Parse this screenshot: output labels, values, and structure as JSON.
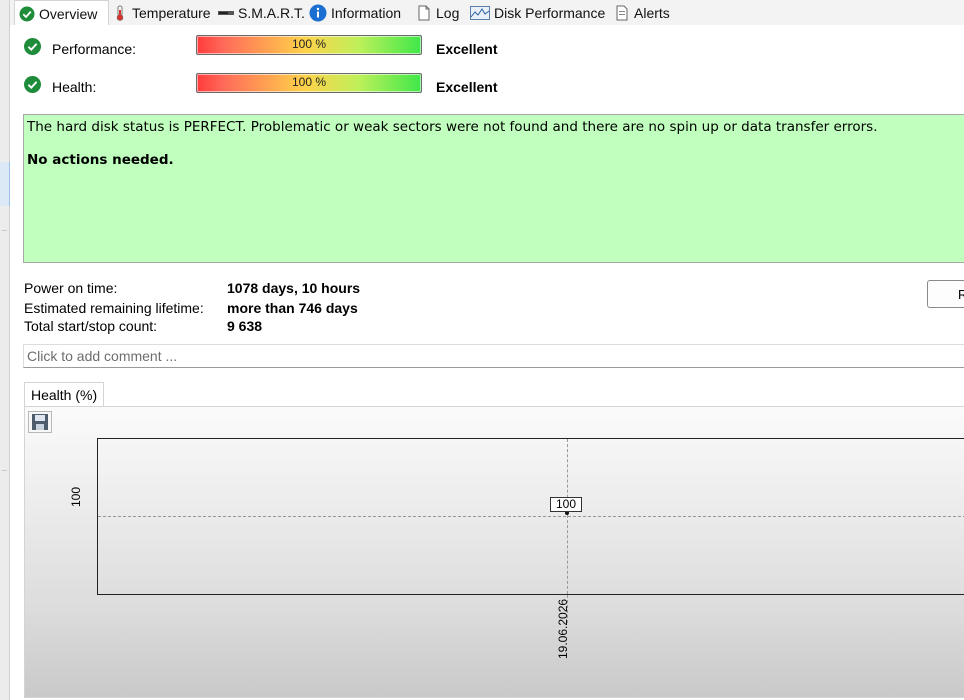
{
  "tabs": [
    {
      "label": "Overview",
      "icon": "check-circle-icon",
      "active": true
    },
    {
      "label": "Temperature",
      "icon": "thermometer-icon"
    },
    {
      "label": "S.M.A.R.T.",
      "icon": "disk-icon"
    },
    {
      "label": "Information",
      "icon": "info-icon"
    },
    {
      "label": "Log",
      "icon": "document-icon"
    },
    {
      "label": "Disk Performance",
      "icon": "chart-icon"
    },
    {
      "label": "Alerts",
      "icon": "alert-document-icon"
    }
  ],
  "performance": {
    "label": "Performance:",
    "percent": "100 %",
    "value": 1.0,
    "rating": "Excellent"
  },
  "health": {
    "label": "Health:",
    "percent": "100 %",
    "value": 1.0,
    "rating": "Excellent"
  },
  "status_message": {
    "text": "The hard disk status is PERFECT. Problematic or weak sectors were not found and there are no spin up or data transfer errors.",
    "action": "No actions needed."
  },
  "info": {
    "power_on_label": "Power on time:",
    "power_on_value": "1078 days, 10 hours",
    "lifetime_label": "Estimated remaining lifetime:",
    "lifetime_value": "more than 746 days",
    "startstop_label": "Total start/stop count:",
    "startstop_value": "9 638"
  },
  "side_button_label": "R",
  "comment": {
    "placeholder": "Click to add comment ..."
  },
  "chart_tab": "Health (%)",
  "chart_data": {
    "type": "line",
    "x": [
      "19.06.2026"
    ],
    "series": [
      {
        "values": [
          100
        ]
      }
    ],
    "ytick": "100",
    "xtick": "19.06.2026",
    "point_label": "100",
    "grid": true
  },
  "colors": {
    "status_bg": "#c0ffbe",
    "ok_icon": "#1e8c3a"
  }
}
